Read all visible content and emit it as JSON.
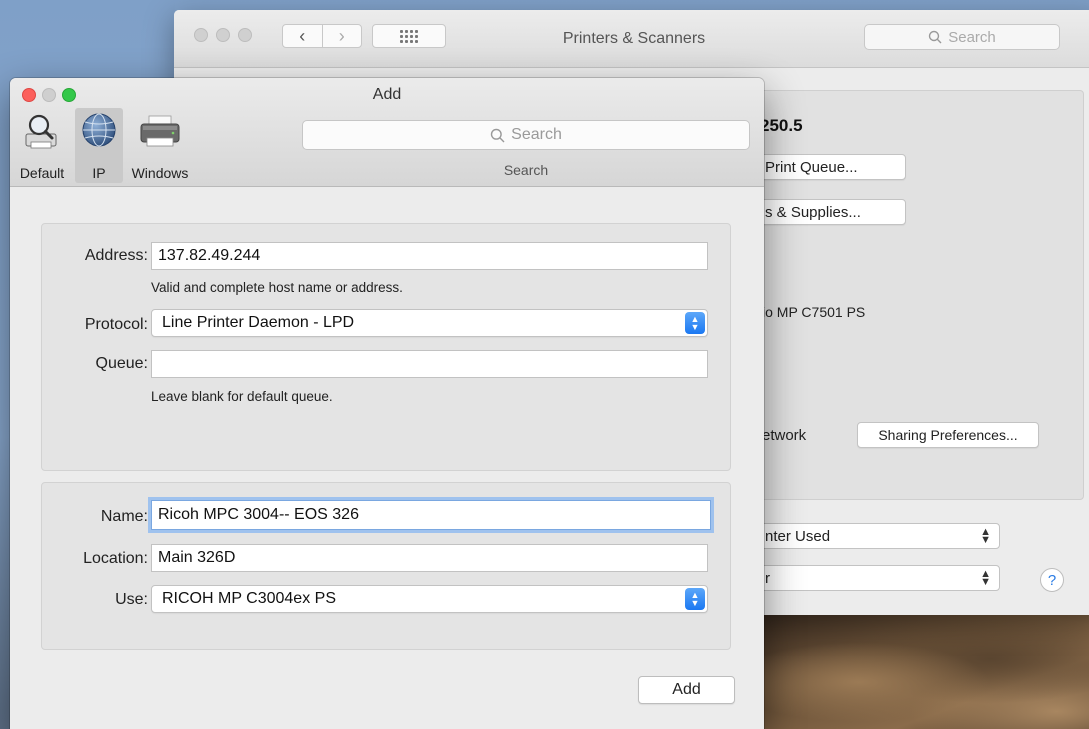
{
  "back_window": {
    "title": "Printers & Scanners",
    "search_placeholder": "Search",
    "printer_name_partial": "250.5",
    "open_print_queue_partial": "Print Queue...",
    "options_supplies_partial": "s & Supplies...",
    "kind_partial": "io MP C7501 PS",
    "share_network_partial": "etwork",
    "sharing_preferences_label": "Sharing Preferences...",
    "default_printer_partial": "nter Used",
    "default_paper_partial": "r",
    "help_label": "?"
  },
  "add_dialog": {
    "title": "Add",
    "toolbar": {
      "items": [
        {
          "label": "Default",
          "icon": "default-printer-icon",
          "selected": false
        },
        {
          "label": "IP",
          "icon": "globe-icon",
          "selected": true
        },
        {
          "label": "Windows",
          "icon": "windows-printer-icon",
          "selected": false
        }
      ],
      "search_placeholder": "Search",
      "search_label": "Search"
    },
    "connection": {
      "address_label": "Address:",
      "address_value": "137.82.49.244",
      "address_hint": "Valid and complete host name or address.",
      "protocol_label": "Protocol:",
      "protocol_value": "Line Printer Daemon - LPD",
      "queue_label": "Queue:",
      "queue_value": "",
      "queue_hint": "Leave blank for default queue."
    },
    "details": {
      "name_label": "Name:",
      "name_value": "Ricoh MPC 3004-- EOS 326",
      "location_label": "Location:",
      "location_value": "Main 326D",
      "use_label": "Use:",
      "use_value": "RICOH MP C3004ex PS"
    },
    "add_button_label": "Add"
  },
  "colors": {
    "accent": "#1b78f2",
    "focus_ring": "#9fc2ee",
    "close": "#fc605c",
    "zoom": "#34c84a"
  }
}
